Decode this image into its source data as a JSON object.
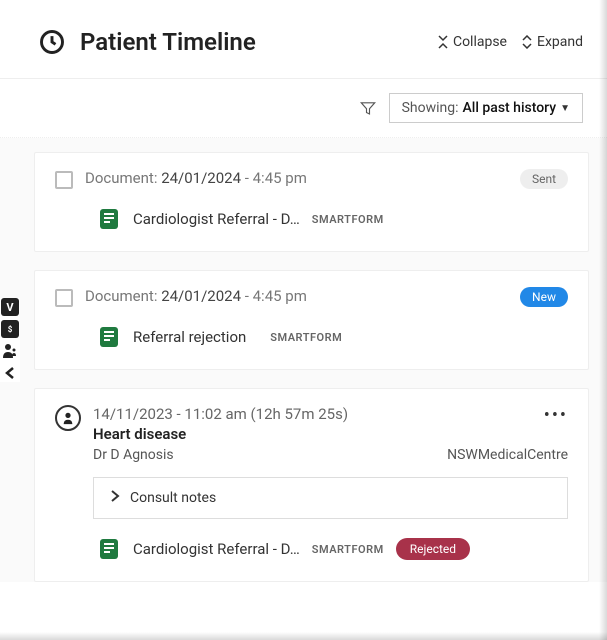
{
  "header": {
    "title": "Patient Timeline",
    "collapse_label": "Collapse",
    "expand_label": "Expand"
  },
  "filter_bar": {
    "showing_label": "Showing:",
    "showing_value": "All past history"
  },
  "side_toolbar": {
    "items": [
      "V",
      "$",
      "person",
      "<"
    ]
  },
  "cards": [
    {
      "type": "document",
      "prefix": "Document:",
      "date": "24/01/2024",
      "time": "4:45 pm",
      "badge": {
        "label": "Sent",
        "kind": "sent"
      },
      "doc": {
        "title": "Cardiologist Referral - D…",
        "tag": "SMARTFORM"
      }
    },
    {
      "type": "document",
      "prefix": "Document:",
      "date": "24/01/2024",
      "time": "4:45 pm",
      "badge": {
        "label": "New",
        "kind": "new"
      },
      "doc": {
        "title": "Referral rejection",
        "tag": "SMARTFORM"
      }
    },
    {
      "type": "encounter",
      "datetime": "14/11/2023 - 11:02 am (12h 57m 25s)",
      "heading": "Heart disease",
      "provider": "Dr D Agnosis",
      "location": "NSWMedicalCentre",
      "consult_notes_label": "Consult notes",
      "doc": {
        "title": "Cardiologist Referral - D…",
        "tag": "SMARTFORM",
        "badge": {
          "label": "Rejected",
          "kind": "rejected"
        }
      }
    }
  ]
}
